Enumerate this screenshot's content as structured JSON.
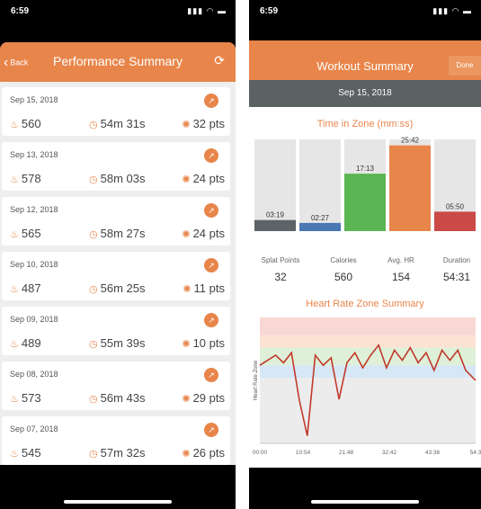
{
  "left": {
    "status_time": "6:59",
    "back_label": "Back",
    "title": "Performance Summary",
    "workouts": [
      {
        "date": "Sep 15, 2018",
        "calories": "560",
        "duration": "54m 31s",
        "points": "32 pts"
      },
      {
        "date": "Sep 13, 2018",
        "calories": "578",
        "duration": "58m 03s",
        "points": "24 pts"
      },
      {
        "date": "Sep 12, 2018",
        "calories": "565",
        "duration": "58m 27s",
        "points": "24 pts"
      },
      {
        "date": "Sep 10, 2018",
        "calories": "487",
        "duration": "56m 25s",
        "points": "11 pts"
      },
      {
        "date": "Sep 09, 2018",
        "calories": "489",
        "duration": "55m 39s",
        "points": "10 pts"
      },
      {
        "date": "Sep 08, 2018",
        "calories": "573",
        "duration": "56m 43s",
        "points": "29 pts"
      },
      {
        "date": "Sep 07, 2018",
        "calories": "545",
        "duration": "57m 32s",
        "points": "26 pts"
      }
    ]
  },
  "right": {
    "status_time": "6:59",
    "title": "Workout Summary",
    "done_label": "Done",
    "date": "Sep 15, 2018",
    "zone_title": "Time in Zone (mm:ss)",
    "metrics": [
      {
        "label": "Splat Points",
        "value": "32"
      },
      {
        "label": "Calories",
        "value": "560"
      },
      {
        "label": "Avg. HR",
        "value": "154"
      },
      {
        "label": "Duration",
        "value": "54:31"
      }
    ],
    "hr_title": "Heart Rate Zone Summary",
    "hr_ylabel": "Heart Rate Zone",
    "hr_ticks": [
      "00:00",
      "10:54",
      "21:48",
      "32:42",
      "43:36",
      "54:3"
    ]
  },
  "colors": {
    "accent": "#e8854a",
    "zone_gray": "#5d6366",
    "zone_blue": "#4a78b5",
    "zone_green": "#5ab552",
    "zone_orange": "#e8854a",
    "zone_red": "#c94a47",
    "hr_line": "#c0392b"
  },
  "chart_data": [
    {
      "type": "bar",
      "title": "Time in Zone (mm:ss)",
      "categories": [
        "zone-1",
        "zone-2",
        "zone-3",
        "zone-4",
        "zone-5"
      ],
      "labels": [
        "03:19",
        "02:27",
        "17:13",
        "25:42",
        "05:50"
      ],
      "values": [
        3.32,
        2.45,
        17.22,
        25.7,
        5.83
      ],
      "ylim": [
        0,
        27.5
      ]
    },
    {
      "type": "line",
      "title": "Heart Rate Zone Summary",
      "ylabel": "Heart Rate Zone",
      "x_ticks": [
        "00:00",
        "10:54",
        "21:48",
        "32:42",
        "43:36",
        "54:3"
      ],
      "x": [
        0,
        2,
        4,
        6,
        8,
        10,
        12,
        14,
        16,
        18,
        20,
        22,
        24,
        26,
        28,
        30,
        32,
        34,
        36,
        38,
        40,
        42,
        44,
        46,
        48,
        50,
        52,
        54.5
      ],
      "y": [
        0.62,
        0.66,
        0.7,
        0.64,
        0.72,
        0.34,
        0.06,
        0.7,
        0.62,
        0.68,
        0.35,
        0.64,
        0.72,
        0.6,
        0.7,
        0.78,
        0.6,
        0.74,
        0.66,
        0.76,
        0.64,
        0.72,
        0.58,
        0.74,
        0.66,
        0.74,
        0.58,
        0.5
      ],
      "ylim": [
        0,
        1
      ]
    }
  ]
}
